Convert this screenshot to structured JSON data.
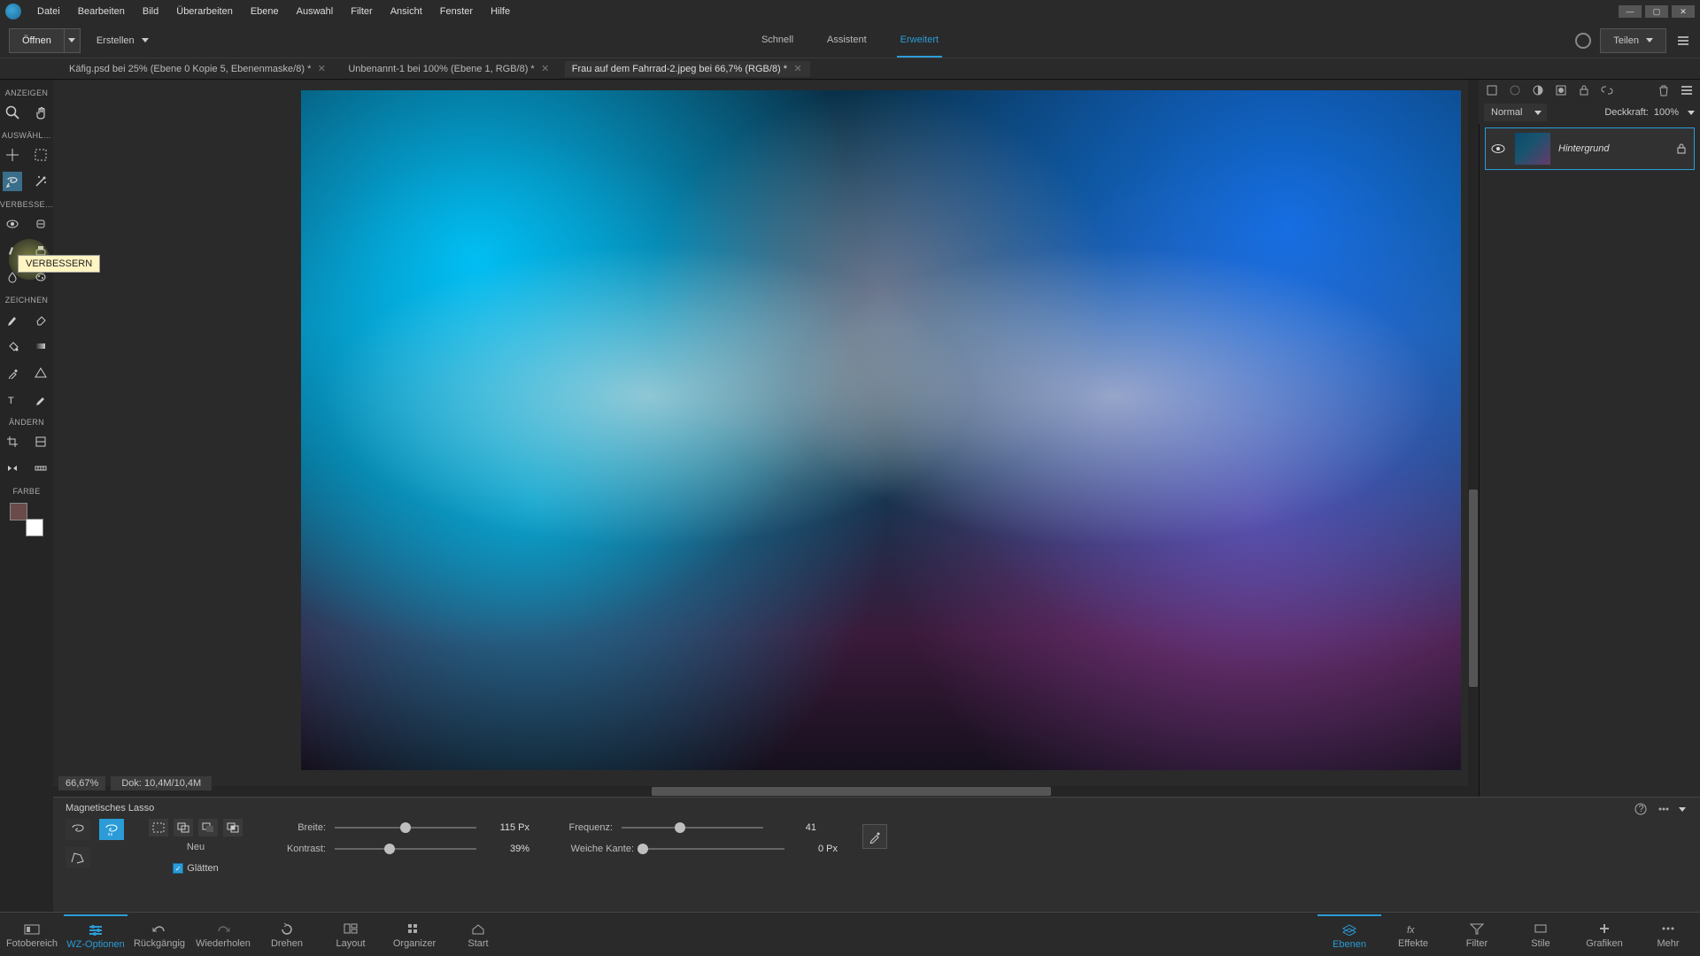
{
  "menubar": {
    "items": [
      "Datei",
      "Bearbeiten",
      "Bild",
      "Überarbeiten",
      "Ebene",
      "Auswahl",
      "Filter",
      "Ansicht",
      "Fenster",
      "Hilfe"
    ]
  },
  "toolbar": {
    "open_label": "Öffnen",
    "create_label": "Erstellen",
    "modes": [
      "Schnell",
      "Assistent",
      "Erweitert"
    ],
    "active_mode_index": 2,
    "share_label": "Teilen"
  },
  "doctabs": [
    {
      "title": "Käfig.psd bei 25% (Ebene 0 Kopie 5, Ebenenmaske/8) *"
    },
    {
      "title": "Unbenannt-1 bei 100% (Ebene 1, RGB/8) *"
    },
    {
      "title": "Frau auf dem Fahrrad-2.jpeg bei 66,7% (RGB/8) *"
    }
  ],
  "active_doc_index": 2,
  "toolbox": {
    "section_anzeigen": "ANZEIGEN",
    "section_auswahl": "AUSWÄHL…",
    "section_verbessern": "VERBESSE…",
    "section_zeichnen": "ZEICHNEN",
    "section_aendern": "ÄNDERN",
    "section_farbe": "FARBE",
    "tooltip": "VERBESSERN"
  },
  "canvas_status": {
    "zoom": "66,67%",
    "dok": "Dok: 10,4M/10,4M"
  },
  "options": {
    "tool_title": "Magnetisches Lasso",
    "neu_label": "Neu",
    "glaetten_label": "Glätten",
    "sliders": {
      "breite": {
        "label": "Breite:",
        "value": "115 Px",
        "pos": 0.5
      },
      "kontrast": {
        "label": "Kontrast:",
        "value": "39%",
        "pos": 0.39
      },
      "frequenz": {
        "label": "Frequenz:",
        "value": "41",
        "pos": 0.41
      },
      "weiche_kante": {
        "label": "Weiche Kante:",
        "value": "0 Px",
        "pos": 0.0
      }
    }
  },
  "layers": {
    "blend_mode": "Normal",
    "opacity_label": "Deckkraft:",
    "opacity_value": "100%",
    "items": [
      {
        "name": "Hintergrund",
        "locked": true
      }
    ]
  },
  "bottombar": {
    "left": [
      {
        "label": "Fotobereich"
      },
      {
        "label": "WZ-Optionen",
        "active": true
      },
      {
        "label": "Rückgängig"
      },
      {
        "label": "Wiederholen"
      },
      {
        "label": "Drehen"
      },
      {
        "label": "Layout"
      },
      {
        "label": "Organizer"
      },
      {
        "label": "Start"
      }
    ],
    "right": [
      {
        "label": "Ebenen",
        "active": true
      },
      {
        "label": "Effekte"
      },
      {
        "label": "Filter"
      },
      {
        "label": "Stile"
      },
      {
        "label": "Grafiken"
      },
      {
        "label": "Mehr"
      }
    ]
  }
}
